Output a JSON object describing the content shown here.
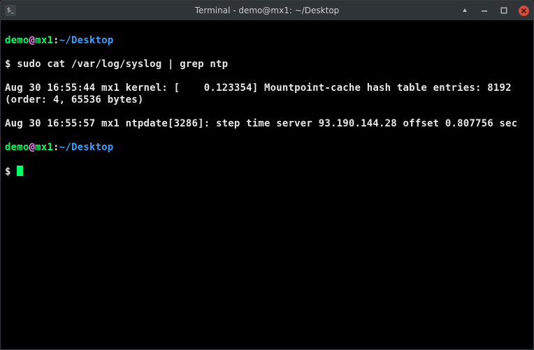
{
  "titlebar": {
    "app_icon_glyph": "$_",
    "title": "Terminal - demo@mx1: ~/Desktop"
  },
  "prompt1": {
    "user": "demo",
    "at": "@",
    "host": "mx1",
    "colon": ":",
    "cwd": "~/Desktop",
    "symbol": "$ ",
    "cmd": "sudo cat /var/log/syslog | grep ntp"
  },
  "output": {
    "line1": "Aug 30 16:55:44 mx1 kernel: [    0.123354] Mountpoint-cache hash table entries: 8192 (order: 4, 65536 bytes)",
    "line2": "Aug 30 16:55:57 mx1 ntpdate[3286]: step time server 93.190.144.28 offset 0.807756 sec"
  },
  "prompt2": {
    "user": "demo",
    "at": "@",
    "host": "mx1",
    "colon": ":",
    "cwd": "~/Desktop",
    "symbol": "$ "
  }
}
